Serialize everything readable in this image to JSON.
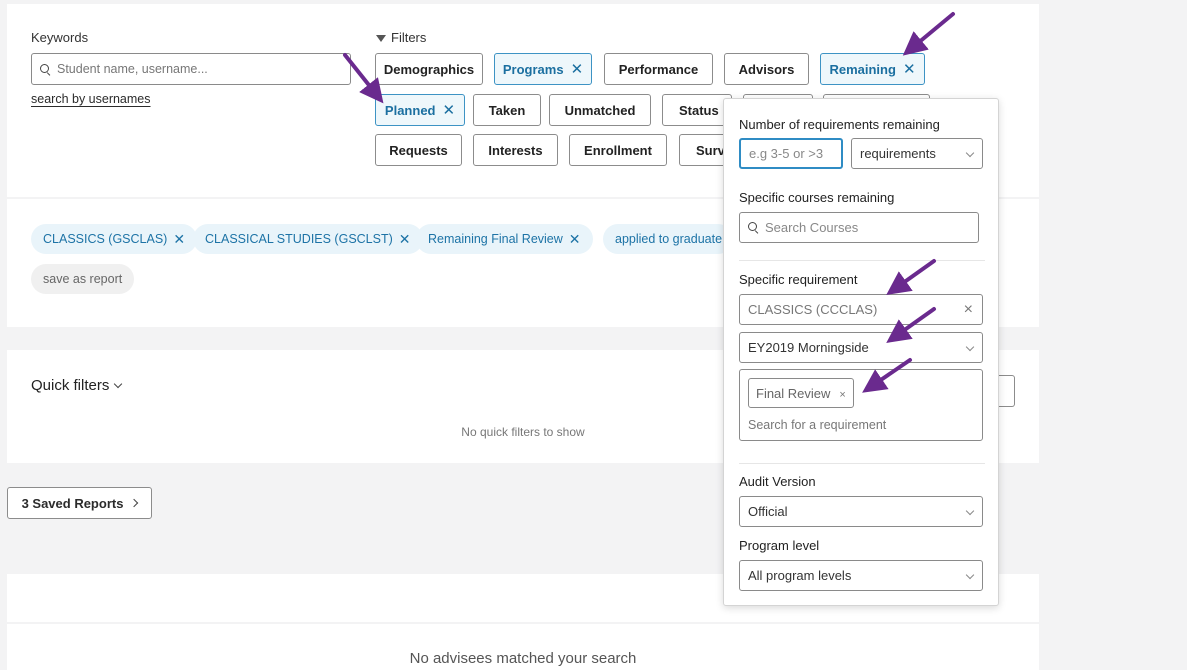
{
  "keywords": {
    "label": "Keywords",
    "placeholder": "Student name, username...",
    "search_by_usernames": "search by usernames"
  },
  "filters": {
    "label": "Filters",
    "buttons": [
      {
        "label": "Demographics",
        "active": false
      },
      {
        "label": "Programs",
        "active": true
      },
      {
        "label": "Performance",
        "active": false
      },
      {
        "label": "Advisors",
        "active": false
      },
      {
        "label": "Remaining",
        "active": true
      },
      {
        "label": "Planned",
        "active": true
      },
      {
        "label": "Taken",
        "active": false
      },
      {
        "label": "Unmatched",
        "active": false
      },
      {
        "label": "Status",
        "active": false
      },
      {
        "label": "Requests",
        "active": false
      },
      {
        "label": "Interests",
        "active": false
      },
      {
        "label": "Enrollment",
        "active": false
      },
      {
        "label": "Surve",
        "active": false
      }
    ]
  },
  "applied_chips": [
    {
      "label": "CLASSICS (GSCLAS)"
    },
    {
      "label": "CLASSICAL STUDIES (GSCLST)"
    },
    {
      "label": "Remaining Final Review"
    },
    {
      "label": "applied to graduate"
    }
  ],
  "save_as_report": "save as report",
  "quick_filters": {
    "title": "Quick filters",
    "empty": "No quick filters to show"
  },
  "saved_reports": "3 Saved Reports",
  "no_advisees": "No advisees matched your search",
  "remaining_panel": {
    "num_label": "Number of requirements remaining",
    "num_placeholder": "e.g 3-5 or >3",
    "num_unit": "requirements",
    "courses_label": "Specific courses remaining",
    "courses_placeholder": "Search Courses",
    "requirement_label": "Specific requirement",
    "requirement_program": "CLASSICS (CCCLAS)",
    "requirement_catalog": "EY2019 Morningside",
    "requirement_tag": "Final Review",
    "requirement_search_placeholder": "Search for a requirement",
    "audit_label": "Audit Version",
    "audit_value": "Official",
    "level_label": "Program level",
    "level_value": "All program levels"
  },
  "colors": {
    "accent": "#1b6fa0",
    "active_bg": "#eef7fb",
    "arrow": "#6a2a8e"
  }
}
